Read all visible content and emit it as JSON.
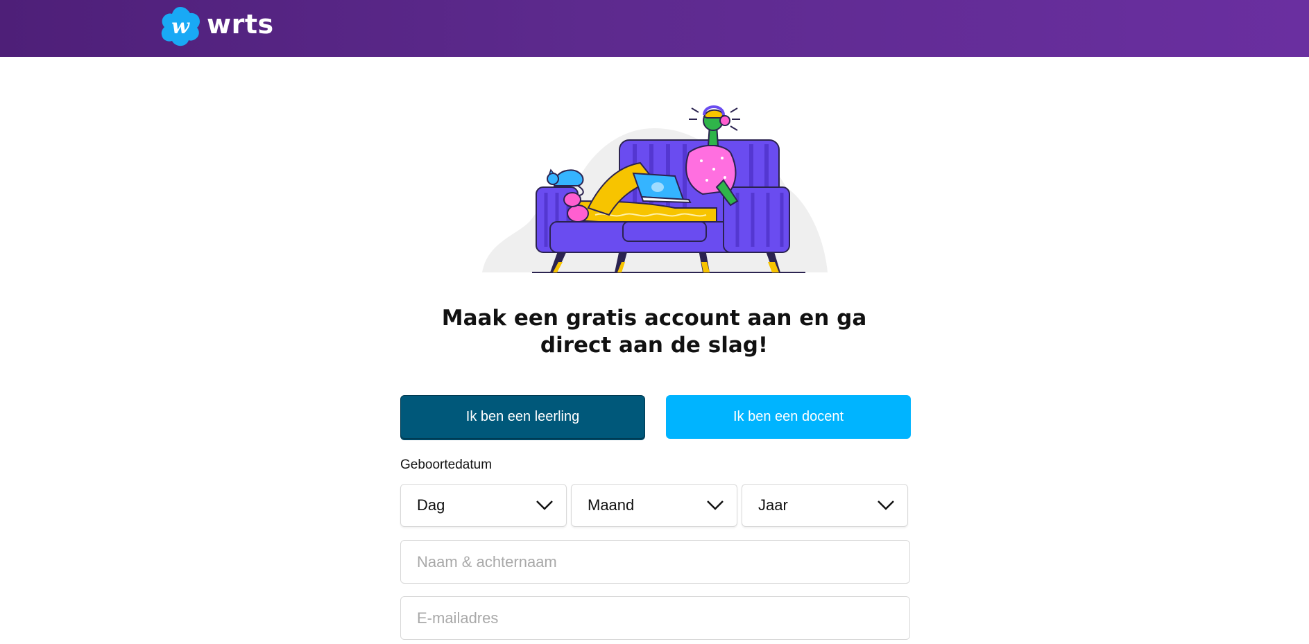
{
  "header": {
    "brand": "wrts",
    "brand_color": "#5d2a8e",
    "logo_icon": "wrts-cloud-logo"
  },
  "main": {
    "headline_line1": "Maak een gratis account aan en ga",
    "headline_line2": "direct aan de slag!",
    "illustration": "person-on-sofa-with-laptop-and-cat"
  },
  "roles": {
    "student_label": "Ik ben een leerling",
    "teacher_label": "Ik ben een docent",
    "student_color": "#00587a",
    "teacher_color": "#00b4ff"
  },
  "form": {
    "birthdate_label": "Geboortedatum",
    "day_select": "Dag",
    "month_select": "Maand",
    "year_select": "Jaar",
    "name_placeholder": "Naam & achternaam",
    "email_placeholder": "E-mailadres"
  }
}
